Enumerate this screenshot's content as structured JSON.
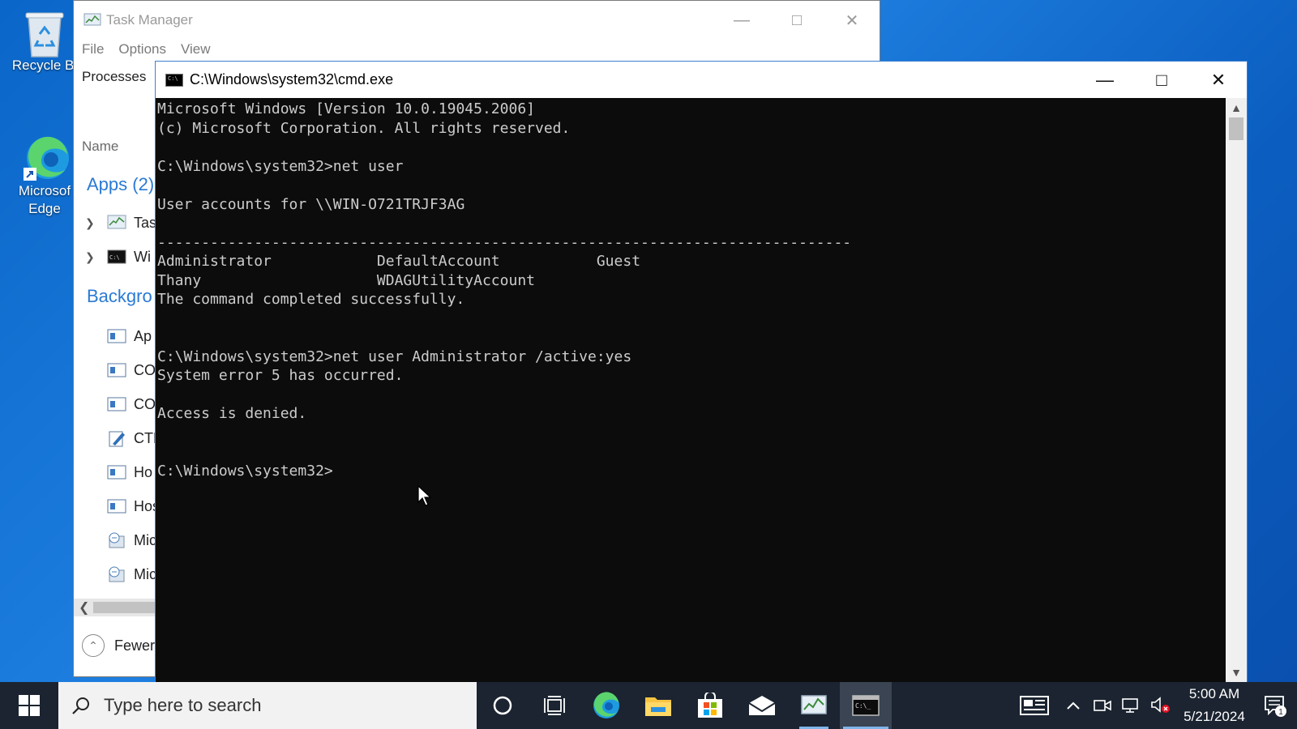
{
  "desktop": {
    "icons": [
      {
        "label": "Recycle Bi"
      },
      {
        "label": "Microsof\nEdge",
        "line1": "Microsof",
        "line2": "Edge"
      }
    ]
  },
  "task_manager": {
    "title": "Task Manager",
    "menu": [
      "File",
      "Options",
      "View"
    ],
    "active_tab": "Processes",
    "column_header": "Name",
    "groups": [
      {
        "label": "Apps (2)"
      },
      {
        "label": "Backgro"
      }
    ],
    "app_rows": [
      {
        "label": "Tas"
      },
      {
        "label": "Wi"
      }
    ],
    "background_rows": [
      {
        "label": "Ap"
      },
      {
        "label": "CO"
      },
      {
        "label": "CO"
      },
      {
        "label": "CTF"
      },
      {
        "label": "Ho"
      },
      {
        "label": "Hos"
      },
      {
        "label": "Mic"
      },
      {
        "label": "Mic"
      }
    ],
    "fewer_details": "Fewer"
  },
  "cmd": {
    "title": "C:\\Windows\\system32\\cmd.exe",
    "lines": [
      "Microsoft Windows [Version 10.0.19045.2006]",
      "(c) Microsoft Corporation. All rights reserved.",
      "",
      "C:\\Windows\\system32>net user",
      "",
      "User accounts for \\\\WIN-O721TRJF3AG",
      "",
      "-------------------------------------------------------------------------------",
      "Administrator            DefaultAccount           Guest",
      "Thany                    WDAGUtilityAccount",
      "The command completed successfully.",
      "",
      "",
      "C:\\Windows\\system32>net user Administrator /active:yes",
      "System error 5 has occurred.",
      "",
      "Access is denied.",
      "",
      "",
      "C:\\Windows\\system32>"
    ]
  },
  "taskbar": {
    "search_placeholder": "Type here to search",
    "apps": [
      "cortana-icon",
      "task-view-icon",
      "edge-icon",
      "file-explorer-icon",
      "store-icon",
      "mail-icon",
      "task-manager-icon",
      "cmd-icon"
    ],
    "clock_time": "5:00 AM",
    "clock_date": "5/21/2024",
    "notification_count": "1"
  },
  "colors": {
    "desktop_bg": "#1e7fe0",
    "taskbar_bg": "#1b2430",
    "console_bg": "#0c0c0c",
    "console_fg": "#cccccc",
    "accent": "#2a7ad4"
  }
}
